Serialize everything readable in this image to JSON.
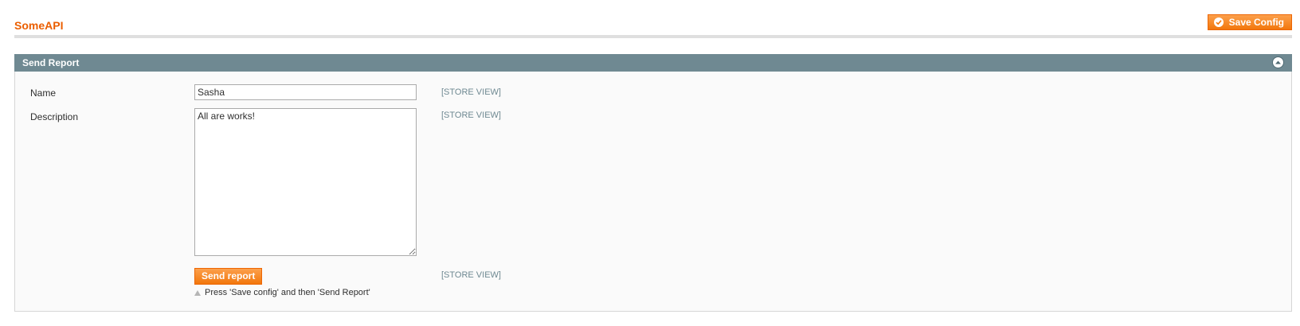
{
  "header": {
    "title": "SomeAPI",
    "save_label": "Save Config"
  },
  "section": {
    "title": "Send Report",
    "fields": {
      "name": {
        "label": "Name",
        "value": "Sasha",
        "scope": "[STORE VIEW]"
      },
      "description": {
        "label": "Description",
        "value": "All are works!",
        "scope": "[STORE VIEW]"
      },
      "send": {
        "button_label": "Send report",
        "scope": "[STORE VIEW]",
        "note": "Press 'Save config' and then 'Send Report'"
      }
    }
  },
  "icons": {
    "save": "check-circle-icon",
    "collapse": "collapse-up-icon",
    "note": "triangle-up-icon"
  },
  "colors": {
    "title": "#eb5e00",
    "button": "#f2770c",
    "section_header": "#6f8992"
  }
}
